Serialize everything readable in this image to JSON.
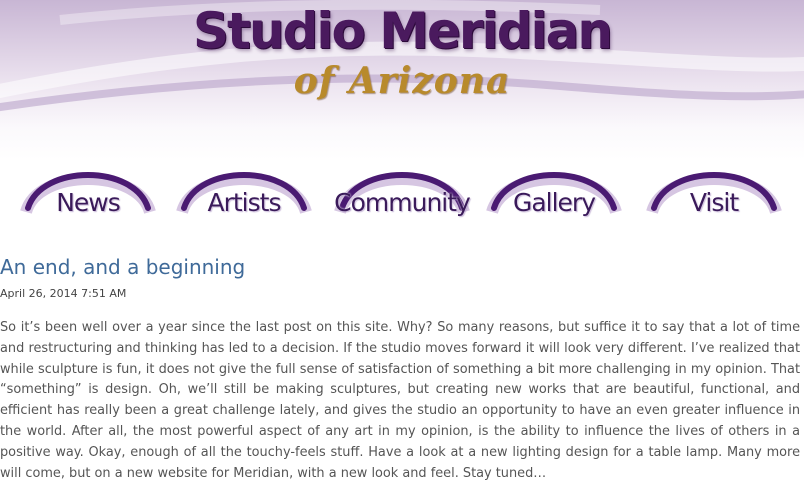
{
  "header": {
    "title": "Studio Meridian",
    "subtitle": "of Arizona"
  },
  "nav": {
    "items": [
      {
        "label": "News"
      },
      {
        "label": "Artists"
      },
      {
        "label": "Community"
      },
      {
        "label": "Gallery"
      },
      {
        "label": "Visit"
      }
    ]
  },
  "post": {
    "title": "An end, and a beginning",
    "date": "April 26, 2014 7:51 AM",
    "body": "So it’s been well over a year since the last post on this site. Why? So many reasons, but suffice it to say that a lot of time and restructuring and thinking has led to a decision. If the studio moves forward it will look very different. I’ve realized that while sculpture is fun, it does not give the full sense of satisfaction of something a bit more challenging in my opinion. That “something” is design. Oh, we’ll still be making sculptures, but creating new works that are beautiful, functional, and efficient has really been a great challenge lately, and gives the studio an opportunity to have an even greater influence in the world. After all, the most powerful aspect of any art in my opinion, is the ability to influence the lives of others in a positive way. Okay, enough of all the touchy-feels stuff. Have a look at a new lighting design for a table lamp. Many more will come, but on a new website for Meridian, with a new look and feel. Stay tuned…"
  },
  "colors": {
    "brand_purple": "#4a1a5e",
    "brand_gold": "#b88a2c",
    "link_blue": "#3f6a99",
    "body_text": "#555555"
  }
}
